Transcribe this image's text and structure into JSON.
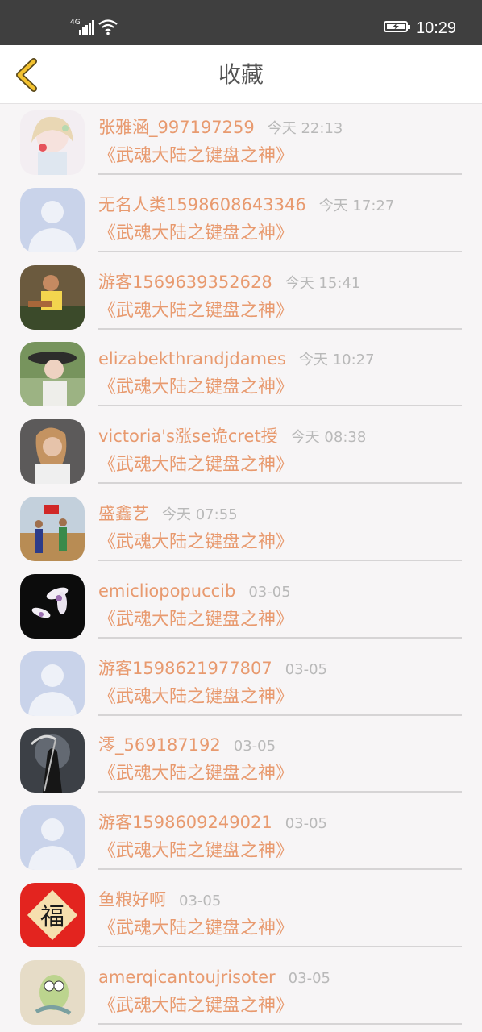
{
  "status_bar": {
    "network": "4G",
    "time": "10:29"
  },
  "header": {
    "title": "收藏"
  },
  "items": [
    {
      "name": "张雅涵_997197259",
      "time": "今天 22:13",
      "book": "《武魂大陆之键盘之神》",
      "avatar": "anime-girl"
    },
    {
      "name": "无名人类1598608643346",
      "time": "今天 17:27",
      "book": "《武魂大陆之键盘之神》",
      "avatar": "default"
    },
    {
      "name": "游客1569639352628",
      "time": "今天 15:41",
      "book": "《武魂大陆之键盘之神》",
      "avatar": "child-photo"
    },
    {
      "name": "elizabekthrandjdames",
      "time": "今天 10:27",
      "book": "《武魂大陆之键盘之神》",
      "avatar": "woman-hat"
    },
    {
      "name": "victoria's涨se诡cret授",
      "time": "今天 08:38",
      "book": "《武魂大陆之键盘之神》",
      "avatar": "woman-portrait"
    },
    {
      "name": "盛鑫艺",
      "time": "今天 07:55",
      "book": "《武魂大陆之键盘之神》",
      "avatar": "outdoor-people"
    },
    {
      "name": "emicliopopuccib",
      "time": "03-05",
      "book": "《武魂大陆之键盘之神》",
      "avatar": "orchid"
    },
    {
      "name": "游客1598621977807",
      "time": "03-05",
      "book": "《武魂大陆之键盘之神》",
      "avatar": "default"
    },
    {
      "name": "澪_569187192",
      "time": "03-05",
      "book": "《武魂大陆之键盘之神》",
      "avatar": "reaper"
    },
    {
      "name": "游客1598609249021",
      "time": "03-05",
      "book": "《武魂大陆之键盘之神》",
      "avatar": "default"
    },
    {
      "name": "鱼粮好啊",
      "time": "03-05",
      "book": "《武魂大陆之键盘之神》",
      "avatar": "fu-sign"
    },
    {
      "name": "amerqicantoujrisoter",
      "time": "03-05",
      "book": "《武魂大陆之键盘之神》",
      "avatar": "cartoon-fish"
    }
  ]
}
